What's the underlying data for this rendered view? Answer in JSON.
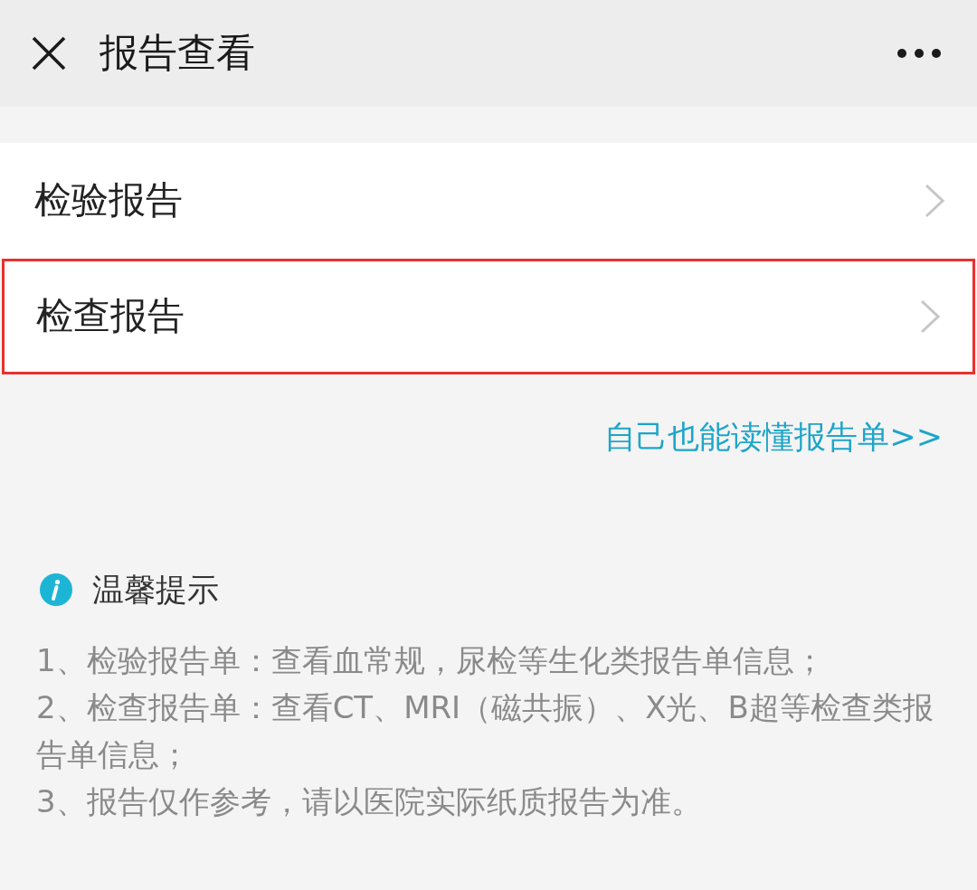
{
  "header": {
    "title": "报告查看"
  },
  "menu": {
    "items": [
      {
        "label": "检验报告",
        "highlighted": false
      },
      {
        "label": "检查报告",
        "highlighted": true
      }
    ]
  },
  "link": {
    "label": "自己也能读懂报告单>>"
  },
  "tips": {
    "title": "温馨提示",
    "lines": [
      "1、检验报告单：查看血常规，尿检等生化类报告单信息；",
      "2、检查报告单：查看CT、MRI（磁共振）、X光、B超等检查类报告单信息；",
      "3、报告仅作参考，请以医院实际纸质报告为准。"
    ]
  }
}
